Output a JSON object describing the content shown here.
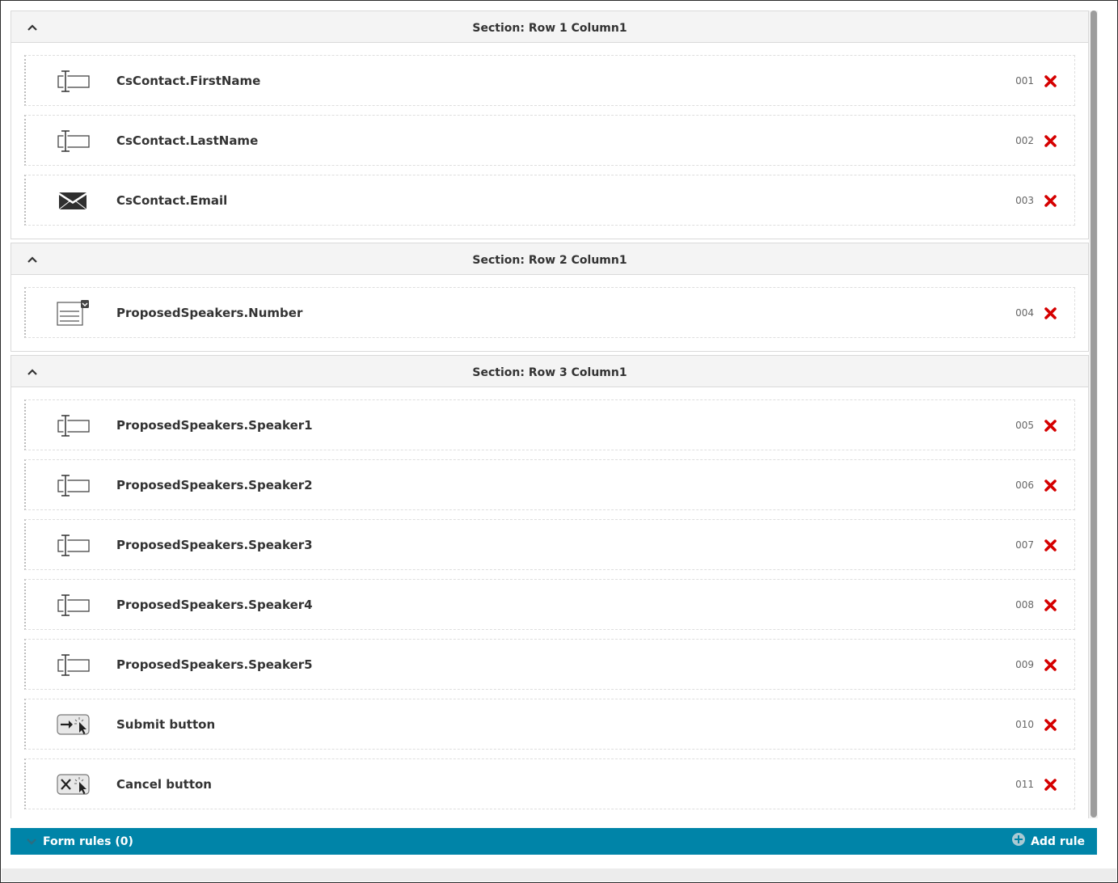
{
  "sections": [
    {
      "title": "Section: Row 1 Column1",
      "fields": [
        {
          "icon": "text-input-icon",
          "label": "CsContact.FirstName",
          "number": "001"
        },
        {
          "icon": "text-input-icon",
          "label": "CsContact.LastName",
          "number": "002"
        },
        {
          "icon": "envelope-icon",
          "label": "CsContact.Email",
          "number": "003"
        }
      ]
    },
    {
      "title": "Section: Row 2 Column1",
      "fields": [
        {
          "icon": "dropdown-list-icon",
          "label": "ProposedSpeakers.Number",
          "number": "004"
        }
      ]
    },
    {
      "title": "Section: Row 3 Column1",
      "fields": [
        {
          "icon": "text-input-icon",
          "label": "ProposedSpeakers.Speaker1",
          "number": "005"
        },
        {
          "icon": "text-input-icon",
          "label": "ProposedSpeakers.Speaker2",
          "number": "006"
        },
        {
          "icon": "text-input-icon",
          "label": "ProposedSpeakers.Speaker3",
          "number": "007"
        },
        {
          "icon": "text-input-icon",
          "label": "ProposedSpeakers.Speaker4",
          "number": "008"
        },
        {
          "icon": "text-input-icon",
          "label": "ProposedSpeakers.Speaker5",
          "number": "009"
        },
        {
          "icon": "submit-button-icon",
          "label": "Submit button",
          "number": "010"
        },
        {
          "icon": "cancel-button-icon",
          "label": "Cancel button",
          "number": "011"
        }
      ]
    }
  ],
  "form_rules": {
    "label": "Form rules (0)",
    "add_rule_label": "Add rule"
  },
  "colors": {
    "accent": "#0084a8",
    "delete": "#d50000",
    "section_header_bg": "#f4f4f4"
  }
}
